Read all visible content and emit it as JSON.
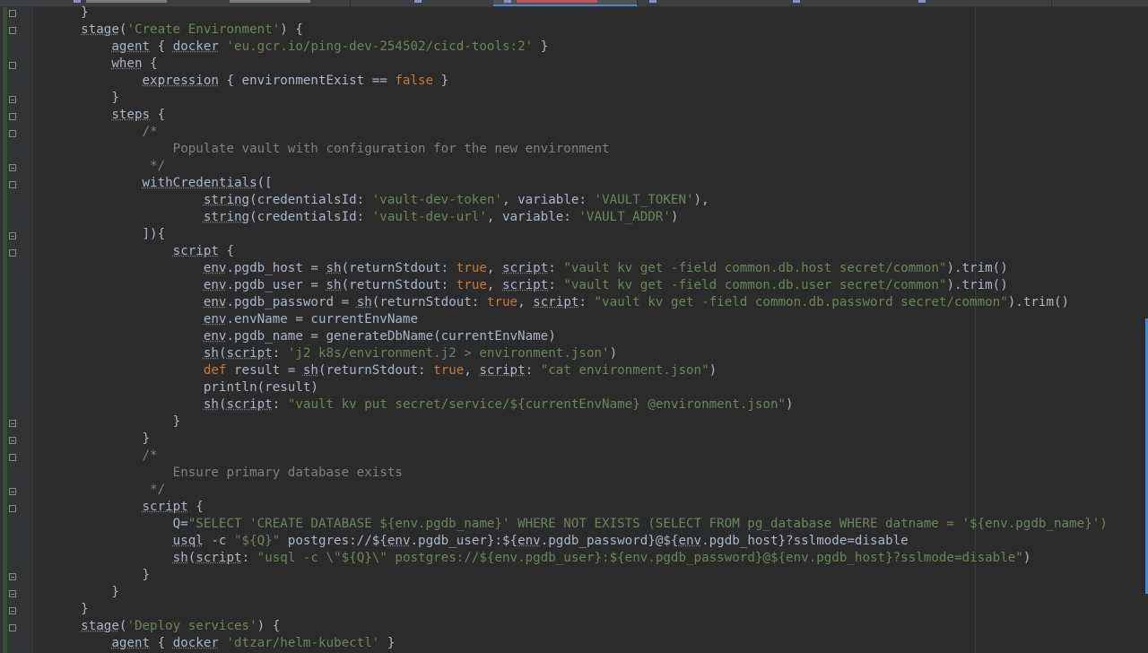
{
  "editor": {
    "code_lines": [
      "    }",
      "    stage('Create Environment') {",
      "        agent { docker 'eu.gcr.io/ping-dev-254502/cicd-tools:2' }",
      "        when {",
      "            expression { environmentExist == false }",
      "        }",
      "        steps {",
      "            /*",
      "                Populate vault with configuration for the new environment",
      "             */",
      "            withCredentials([",
      "                    string(credentialsId: 'vault-dev-token', variable: 'VAULT_TOKEN'),",
      "                    string(credentialsId: 'vault-dev-url', variable: 'VAULT_ADDR')",
      "            ]){",
      "                script {",
      "                    env.pgdb_host = sh(returnStdout: true, script: \"vault kv get -field common.db.host secret/common\").trim()",
      "                    env.pgdb_user = sh(returnStdout: true, script: \"vault kv get -field common.db.user secret/common\").trim()",
      "                    env.pgdb_password = sh(returnStdout: true, script: \"vault kv get -field common.db.password secret/common\").trim()",
      "                    env.envName = currentEnvName",
      "                    env.pgdb_name = generateDbName(currentEnvName)",
      "                    sh(script: 'j2 k8s/environment.j2 > environment.json')",
      "                    def result = sh(returnStdout: true, script: \"cat environment.json\")",
      "                    println(result)",
      "                    sh(script: \"vault kv put secret/service/${currentEnvName} @environment.json\")",
      "                }",
      "            }",
      "            /*",
      "                Ensure primary database exists",
      "             */",
      "            script {",
      "                Q=\"SELECT 'CREATE DATABASE ${env.pgdb_name}' WHERE NOT EXISTS (SELECT FROM pg_database WHERE datname = '${env.pgdb_name}')",
      "                usql -c \"${Q}\" postgres://${env.pgdb_user}:${env.pgdb_password}@${env.pgdb_host}?sslmode=disable",
      "                sh(script: \"usql -c \\\"${Q}\\\" postgres://${env.pgdb_user}:${env.pgdb_password}@${env.pgdb_host}?sslmode=disable\")",
      "            }",
      "        }",
      "    }",
      "    stage('Deploy services') {",
      "        agent { docker 'dtzar/helm-kubectl' }"
    ]
  }
}
